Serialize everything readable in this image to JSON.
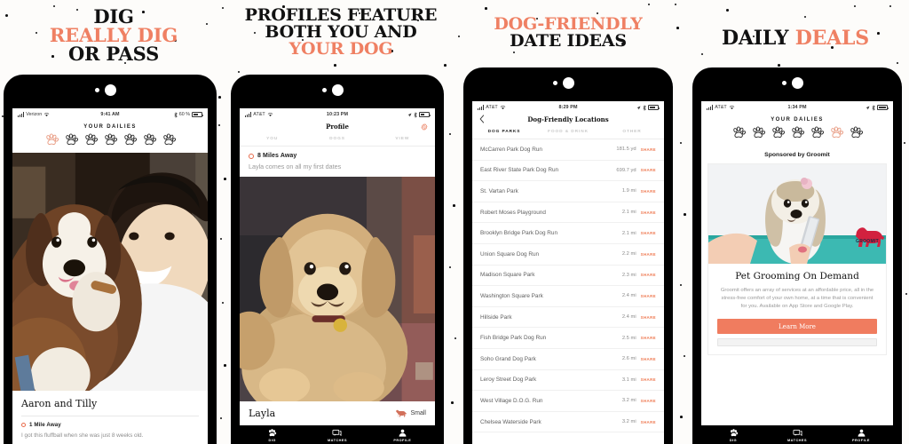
{
  "theme": {
    "accent": "#ef8063",
    "accent_button": "#f07c5f",
    "ink": "#111111",
    "page_bg": "#fdfcfa"
  },
  "panels": [
    {
      "headline": {
        "lines": [
          {
            "text": "DIG",
            "accent": false
          },
          {
            "text": "REALLY DIG",
            "accent": true
          },
          {
            "text": "OR PASS",
            "accent": false
          }
        ]
      },
      "status": {
        "carrier": "Verizon",
        "time": "9:41 AM",
        "battery": "60 %"
      },
      "header_title": "YOUR DAILIES",
      "paw_count": 7,
      "paw_active_index": 0,
      "card": {
        "name": "Aaron and Tilly",
        "distance": "1 Mile Away",
        "bio": "I got this fluffball when she was just 8 weeks old."
      }
    },
    {
      "headline": {
        "lines": [
          {
            "text": "PROFILES FEATURE",
            "accent": false
          },
          {
            "text": "BOTH YOU AND",
            "accent": false
          },
          {
            "text": "YOUR DOG",
            "accent": true
          }
        ]
      },
      "status": {
        "carrier": "AT&T",
        "time": "10:23 PM",
        "battery": ""
      },
      "nav_title": "Profile",
      "gear_icon": "gear-icon",
      "tabs": [
        {
          "label": "YOU",
          "active": false
        },
        {
          "label": "DOGS",
          "active": false
        },
        {
          "label": "VIEW",
          "active": false
        }
      ],
      "about": {
        "distance": "8 Miles Away",
        "bio": "Layla comes on all my first dates"
      },
      "dog": {
        "name": "Layla",
        "size": "Small",
        "size_icon": "dog-icon"
      },
      "tabbar": [
        {
          "label": "DIG",
          "icon": "paw-icon"
        },
        {
          "label": "MATCHES",
          "icon": "chat-icon"
        },
        {
          "label": "PROFILE",
          "icon": "person-icon"
        }
      ]
    },
    {
      "headline": {
        "lines": [
          {
            "text": "DOG-FRIENDLY",
            "accent": true
          },
          {
            "text": "DATE IDEAS",
            "accent": false
          }
        ]
      },
      "status": {
        "carrier": "AT&T",
        "time": "8:29 PM",
        "battery": ""
      },
      "nav_title": "Dog-Friendly Locations",
      "back_icon": "chevron-left-icon",
      "tabs": [
        {
          "label": "DOG PARKS",
          "active": true
        },
        {
          "label": "FOOD & DRINK",
          "active": false
        },
        {
          "label": "OTHER",
          "active": false
        }
      ],
      "share_label": "SHARE",
      "locations": [
        {
          "name": "McCarren Park Dog Run",
          "distance": "181.5 yd"
        },
        {
          "name": "East River State Park Dog Run",
          "distance": "699.7 yd"
        },
        {
          "name": "St. Vartan Park",
          "distance": "1.9 mi"
        },
        {
          "name": "Robert Moses Playground",
          "distance": "2.1 mi"
        },
        {
          "name": "Brooklyn Bridge Park Dog Run",
          "distance": "2.1 mi"
        },
        {
          "name": "Union Square Dog Run",
          "distance": "2.2 mi"
        },
        {
          "name": "Madison Square Park",
          "distance": "2.3 mi"
        },
        {
          "name": "Washington Square Park",
          "distance": "2.4 mi"
        },
        {
          "name": "Hillside Park",
          "distance": "2.4 mi"
        },
        {
          "name": "Fish Bridge Park Dog Run",
          "distance": "2.5 mi"
        },
        {
          "name": "Soho Grand Dog Park",
          "distance": "2.6 mi"
        },
        {
          "name": "Leroy Street Dog Park",
          "distance": "3.1 mi"
        },
        {
          "name": "West Village D.O.G. Run",
          "distance": "3.2 mi"
        },
        {
          "name": "Chelsea Waterside Park",
          "distance": "3.2 mi"
        }
      ]
    },
    {
      "headline": {
        "lines": [
          {
            "text": "DAILY ",
            "accent": false,
            "inline": true
          },
          {
            "text": "DEALS",
            "accent": true,
            "inline": true
          }
        ]
      },
      "status": {
        "carrier": "AT&T",
        "time": "1:34 PM",
        "battery": ""
      },
      "header_title": "YOUR DAILIES",
      "paw_count": 7,
      "paw_active_index": 5,
      "sponsored_label": "Sponsored by Groomit",
      "ad": {
        "brand": "GROOMIT",
        "heading": "Pet Grooming On Demand",
        "body": "Groomit offers an array of services at an affordable price, all in the stress-free comfort of your own home, at a time that is convenient for you. Available on App Store and Google Play.",
        "cta": "Learn More"
      },
      "tabbar": [
        {
          "label": "DIG",
          "icon": "paw-icon"
        },
        {
          "label": "MATCHES",
          "icon": "chat-icon"
        },
        {
          "label": "PROFILE",
          "icon": "person-icon"
        }
      ]
    }
  ]
}
